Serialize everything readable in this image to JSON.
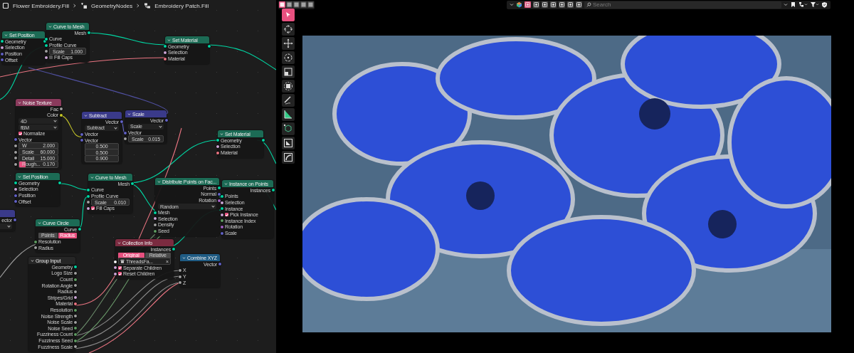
{
  "breadcrumb": [
    {
      "kind": "object",
      "label": "Flower Embroidery.Fill"
    },
    {
      "kind": "modifier",
      "label": "GeometryNodes"
    },
    {
      "kind": "nodetree",
      "label": "Embroidery Patch.Fill"
    }
  ],
  "nodes": [
    {
      "title": "Set Position",
      "color": "#1c6b55",
      "rows": [
        {
          "kind": "io",
          "label": "Geometry",
          "color": "#00d6a3"
        },
        {
          "kind": "in",
          "label": "Selection",
          "color": "#cca6d6"
        },
        {
          "kind": "in",
          "label": "Position",
          "color": "#6363c7"
        },
        {
          "kind": "in",
          "label": "Offset",
          "color": "#6363c7"
        }
      ]
    },
    {
      "title": "Curve to Mesh",
      "color": "#1c6b55",
      "rows": [
        {
          "kind": "out",
          "label": "Mesh",
          "color": "#00d6a3"
        },
        {
          "kind": "in",
          "label": "Curve",
          "color": "#00d6a3"
        },
        {
          "kind": "in",
          "label": "Profile Curve",
          "color": "#00d6a3"
        },
        {
          "kind": "field",
          "label": "Scale",
          "value": "1.000",
          "color": "#a1a1a1"
        },
        {
          "kind": "check",
          "label": "Fill Caps",
          "checked": false,
          "color": "#cca6d6"
        }
      ]
    },
    {
      "title": "Set Material",
      "color": "#1c6b55",
      "rows": [
        {
          "kind": "io",
          "label": "Geometry",
          "color": "#00d6a3"
        },
        {
          "kind": "in",
          "label": "Selection",
          "color": "#cca6d6"
        },
        {
          "kind": "in",
          "label": "Material",
          "color": "#eb7582"
        }
      ]
    },
    {
      "title": "Noise Texture",
      "color": "#8a3a5c",
      "rows": [
        {
          "kind": "out",
          "label": "Fac",
          "color": "#a1a1a1"
        },
        {
          "kind": "out",
          "label": "Color",
          "color": "#c7c729"
        },
        {
          "kind": "dropdown",
          "value": "4D"
        },
        {
          "kind": "dropdown",
          "value": "fBM"
        },
        {
          "kind": "check",
          "label": "Normalize",
          "checked": true
        },
        {
          "kind": "in",
          "label": "Vector",
          "color": "#6363c7"
        },
        {
          "kind": "field",
          "label": "W",
          "value": "2.000",
          "color": "#a1a1a1"
        },
        {
          "kind": "field",
          "label": "Scale",
          "value": "60.000",
          "color": "#a1a1a1"
        },
        {
          "kind": "field",
          "label": "Detail",
          "value": "15.000",
          "color": "#a1a1a1"
        },
        {
          "kind": "slider",
          "label": "Rough...",
          "value": "0.170",
          "level": 0.17,
          "color": "#a1a1a1"
        }
      ]
    },
    {
      "title": "Subtract",
      "color": "#3a3a8a",
      "rows": [
        {
          "kind": "out",
          "label": "Vector",
          "color": "#6363c7"
        },
        {
          "kind": "dropdown",
          "value": "Subtract"
        },
        {
          "kind": "in",
          "label": "Vector",
          "color": "#6363c7"
        },
        {
          "kind": "in",
          "label": "Vector",
          "color": "#6363c7"
        },
        {
          "kind": "value",
          "value": "0.500"
        },
        {
          "kind": "value",
          "value": "0.500"
        },
        {
          "kind": "value",
          "value": "0.900"
        }
      ]
    },
    {
      "title": "Scale",
      "color": "#3a3a8a",
      "rows": [
        {
          "kind": "out",
          "label": "Vector",
          "color": "#6363c7"
        },
        {
          "kind": "dropdown",
          "value": "Scale"
        },
        {
          "kind": "in",
          "label": "Vector",
          "color": "#6363c7"
        },
        {
          "kind": "field",
          "label": "Scale",
          "value": "0.015",
          "color": "#a1a1a1"
        }
      ]
    },
    {
      "title": "Set Material",
      "color": "#1c6b55",
      "rows": [
        {
          "kind": "io",
          "label": "Geometry",
          "color": "#00d6a3"
        },
        {
          "kind": "in",
          "label": "Selection",
          "color": "#cca6d6"
        },
        {
          "kind": "in",
          "label": "Material",
          "color": "#eb7582"
        }
      ]
    },
    {
      "title": "Set Position",
      "color": "#1c6b55",
      "rows": [
        {
          "kind": "io",
          "label": "Geometry",
          "color": "#00d6a3"
        },
        {
          "kind": "in",
          "label": "Selection",
          "color": "#cca6d6"
        },
        {
          "kind": "in",
          "label": "Position",
          "color": "#6363c7"
        },
        {
          "kind": "in",
          "label": "Offset",
          "color": "#6363c7"
        }
      ]
    },
    {
      "title": "Curve to Mesh",
      "color": "#1c6b55",
      "rows": [
        {
          "kind": "out",
          "label": "Mesh",
          "color": "#00d6a3"
        },
        {
          "kind": "in",
          "label": "Curve",
          "color": "#00d6a3"
        },
        {
          "kind": "in",
          "label": "Profile Curve",
          "color": "#00d6a3"
        },
        {
          "kind": "field",
          "label": "Scale",
          "value": "0.010",
          "color": "#a1a1a1"
        },
        {
          "kind": "check",
          "label": "Fill Caps",
          "checked": true,
          "color": "#cca6d6"
        }
      ]
    },
    {
      "title": "Distribute Points on Fac...",
      "color": "#1c6b55",
      "rows": [
        {
          "kind": "out",
          "label": "Points",
          "color": "#00d6a3"
        },
        {
          "kind": "out",
          "label": "Normal",
          "color": "#6363c7"
        },
        {
          "kind": "out",
          "label": "Rotation",
          "color": "#a663c7"
        },
        {
          "kind": "dropdown",
          "value": "Random"
        },
        {
          "kind": "in",
          "label": "Mesh",
          "color": "#00d6a3"
        },
        {
          "kind": "in",
          "label": "Selection",
          "color": "#cca6d6"
        },
        {
          "kind": "in",
          "label": "Density",
          "color": "#a1a1a1"
        },
        {
          "kind": "in",
          "label": "Seed",
          "color": "#5f9c62"
        }
      ]
    },
    {
      "title": "Instance on Points",
      "color": "#1c6b55",
      "rows": [
        {
          "kind": "out",
          "label": "Instances",
          "color": "#00d6a3"
        },
        {
          "kind": "in",
          "label": "Points",
          "color": "#00d6a3"
        },
        {
          "kind": "in",
          "label": "Selection",
          "color": "#cca6d6"
        },
        {
          "kind": "in",
          "label": "Instance",
          "color": "#00d6a3"
        },
        {
          "kind": "check",
          "label": "Pick Instance",
          "checked": true,
          "color": "#cca6d6"
        },
        {
          "kind": "in",
          "label": "Instance Index",
          "color": "#5f9c62"
        },
        {
          "kind": "in",
          "label": "Rotation",
          "color": "#a663c7"
        },
        {
          "kind": "in",
          "label": "Scale",
          "color": "#6363c7"
        }
      ]
    },
    {
      "color": "#3a3a8a",
      "rows": [
        {
          "kind": "out",
          "label": "ector",
          "color": "#6363c7"
        },
        {
          "kind": "dropdown"
        }
      ]
    },
    {
      "title": "Curve Circle",
      "color": "#1c6b55",
      "rows": [
        {
          "kind": "out",
          "label": "Curve",
          "color": "#00d6a3"
        },
        {
          "kind": "toggle",
          "options": [
            {
              "label": "Points",
              "selected": false
            },
            {
              "label": "Radius",
              "selected": true
            }
          ]
        },
        {
          "kind": "in",
          "label": "Resolution",
          "color": "#5f9c62"
        },
        {
          "kind": "in",
          "label": "Radius",
          "color": "#a1a1a1"
        }
      ]
    },
    {
      "title": "Collection Info",
      "color": "#7b2b40",
      "rows": [
        {
          "kind": "out",
          "label": "Instances",
          "color": "#00d6a3"
        },
        {
          "kind": "toggle",
          "options": [
            {
              "label": "Original",
              "selected": true
            },
            {
              "label": "Relative",
              "selected": false
            }
          ]
        },
        {
          "kind": "collection",
          "value": "ThreadsFa...",
          "clear": "×",
          "color": "#f5f5f5"
        },
        {
          "kind": "check",
          "label": "Separate Children",
          "checked": true,
          "color": "#cca6d6"
        },
        {
          "kind": "check",
          "label": "Reset Children",
          "checked": true,
          "color": "#cca6d6"
        }
      ]
    },
    {
      "title": "Combine XYZ",
      "color": "#1f5b83",
      "rows": [
        {
          "kind": "out",
          "label": "Vector",
          "color": "#6363c7"
        },
        {
          "kind": "in",
          "label": "X",
          "color": "#a1a1a1"
        },
        {
          "kind": "in",
          "label": "Y",
          "color": "#a1a1a1"
        },
        {
          "kind": "in",
          "label": "Z",
          "color": "#a1a1a1"
        }
      ]
    },
    {
      "title": "Group Input",
      "color": "#262626",
      "rows": [
        {
          "kind": "out",
          "label": "Geometry",
          "color": "#00d6a3"
        },
        {
          "kind": "out",
          "label": "Logo Size",
          "color": "#a1a1a1"
        },
        {
          "kind": "out",
          "label": "Count",
          "color": "#5f9c62"
        },
        {
          "kind": "out",
          "label": "Rotation Angle",
          "color": "#a1a1a1"
        },
        {
          "kind": "out",
          "label": "Radius",
          "color": "#a1a1a1"
        },
        {
          "kind": "out",
          "label": "Stripes/Grid",
          "color": "#cca6d6"
        },
        {
          "kind": "out",
          "label": "Material",
          "color": "#eb7582"
        },
        {
          "kind": "out",
          "label": "Resolution",
          "color": "#5f9c62"
        },
        {
          "kind": "out",
          "label": "Noise Strength",
          "color": "#a1a1a1"
        },
        {
          "kind": "out",
          "label": "Noise Scale",
          "color": "#a1a1a1"
        },
        {
          "kind": "out",
          "label": "Noise Seed",
          "color": "#5f9c62"
        },
        {
          "kind": "out",
          "label": "Fuzziness Count",
          "color": "#5f9c62"
        },
        {
          "kind": "out",
          "label": "Fuzziness Seed",
          "color": "#5f9c62"
        },
        {
          "kind": "out",
          "label": "Fuzziness Scale",
          "color": "#a1a1a1"
        }
      ]
    }
  ],
  "viewport": {
    "mode_buttons": [
      {
        "selected": true
      },
      {
        "selected": false
      },
      {
        "selected": false
      },
      {
        "selected": false
      },
      {
        "selected": false
      }
    ],
    "filter_toggles": [
      {
        "selected": true
      },
      {
        "selected": false
      },
      {
        "selected": false
      },
      {
        "selected": false
      },
      {
        "selected": false
      },
      {
        "selected": false
      },
      {
        "selected": false
      }
    ],
    "search": {
      "placeholder": "Search"
    },
    "tools": [
      {
        "kind": "select",
        "selected": true
      },
      {
        "kind": "cursor",
        "selected": false
      },
      {
        "kind": "move",
        "selected": false
      },
      {
        "kind": "rotate",
        "selected": false
      },
      {
        "kind": "scale",
        "selected": false
      },
      {
        "kind": "transform",
        "selected": false
      },
      {
        "kind": "annotate",
        "selected": false
      },
      {
        "kind": "measure",
        "selected": false
      },
      {
        "kind": "add_cube",
        "selected": false
      },
      {
        "kind": "shear",
        "selected": false
      },
      {
        "kind": "bend",
        "selected": false
      }
    ]
  }
}
